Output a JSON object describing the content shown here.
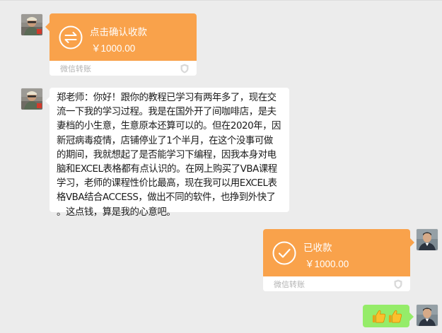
{
  "messages": [
    {
      "type": "transfer",
      "title": "点击确认收款",
      "amount": "￥1000.00",
      "label": "微信转账",
      "icon": "transfer-arrows-icon"
    },
    {
      "type": "text",
      "lines": [
        "郑老师：你好！跟你的教程已学习有两年多了，现在交",
        "流一下我的学习过程。我是在国外开了间咖啡店，是夫",
        "妻档的小生意，生意原本还算可以的。但在2020年，因",
        "新冠病毒疫情，店铺停业了1个半月，在这个没事可做",
        "的期间，我就想起了是否能学习下编程，因我本身对电",
        "脑和EXCEL表格都有点认识的。在网上购买了VBA课程",
        "学习，老师的课程性价比最高，现在我可以用EXCEL表",
        "格VBA结合ACCESS，做出不同的软件，也挣到外快了",
        "。这点钱，算是我的心意吧。"
      ]
    },
    {
      "type": "transfer",
      "title": "已收款",
      "amount": "￥1000.00",
      "label": "微信转账",
      "icon": "check-circle-icon"
    },
    {
      "type": "emoji",
      "icons": [
        "thumbs-up-icon",
        "thumbs-up-icon"
      ]
    }
  ],
  "colors": {
    "background": "#ececec",
    "transfer_orange": "#f9a24b",
    "sent_green": "#95ec69"
  }
}
